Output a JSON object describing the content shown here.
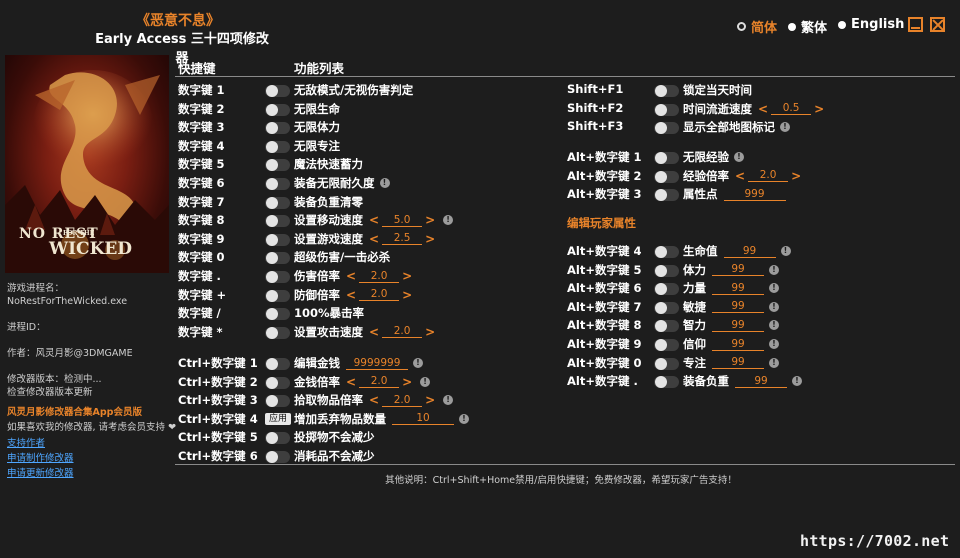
{
  "header": {
    "game_title": "《恶意不息》",
    "app_title": "Early Access 三十四项修改器",
    "languages": [
      {
        "label": "简体",
        "active": true
      },
      {
        "label": "繁体",
        "active": false
      },
      {
        "label": "English",
        "active": false
      }
    ]
  },
  "sidebar": {
    "cover_title_top": "NO REST",
    "cover_title_mid": "FOR THE",
    "cover_title_bottom": "WICKED",
    "process_name_label": "游戏进程名：",
    "process_name": "NoRestForTheWicked.exe",
    "process_id_label": "进程ID：",
    "author": "作者：风灵月影@3DMGAME",
    "version": "修改器版本：检测中...",
    "check_update": "检查修改器版本更新",
    "vip_title": "风灵月影修改器合集App会员版",
    "vip_desc": "如果喜欢我的修改器, 请考虑会员支持",
    "links": [
      "支持作者",
      "申请制作修改器",
      "申请更新修改器"
    ]
  },
  "table": {
    "col_hotkey": "快捷键",
    "col_function": "功能列表",
    "left_rows": [
      {
        "key": "数字键 1",
        "label": "无敌模式/无视伤害判定"
      },
      {
        "key": "数字键 2",
        "label": "无限生命"
      },
      {
        "key": "数字键 3",
        "label": "无限体力"
      },
      {
        "key": "数字键 4",
        "label": "无限专注"
      },
      {
        "key": "数字键 5",
        "label": "魔法快速蓄力"
      },
      {
        "key": "数字键 6",
        "label": "装备无限耐久度",
        "warn": "!"
      },
      {
        "key": "数字键 7",
        "label": "装备负重清零"
      },
      {
        "key": "数字键 8",
        "label": "设置移动速度",
        "value": "5.0",
        "warn": "!"
      },
      {
        "key": "数字键 9",
        "label": "设置游戏速度",
        "value": "2.5"
      },
      {
        "key": "数字键 0",
        "label": "超级伤害/一击必杀"
      },
      {
        "key": "数字键 .",
        "label": "伤害倍率",
        "value": "2.0"
      },
      {
        "key": "数字键 +",
        "label": "防御倍率",
        "value": "2.0"
      },
      {
        "key": "数字键 /",
        "label": "100%暴击率"
      },
      {
        "key": "数字键 *",
        "label": "设置攻击速度",
        "value": "2.0"
      }
    ],
    "ctrl_rows": [
      {
        "key": "Ctrl+数字键 1",
        "label": "编辑金钱",
        "input": "9999999",
        "warn": "!"
      },
      {
        "key": "Ctrl+数字键 2",
        "label": "金钱倍率",
        "value": "2.0",
        "warn": "!"
      },
      {
        "key": "Ctrl+数字键 3",
        "label": "拾取物品倍率",
        "value": "2.0",
        "warn": "!"
      },
      {
        "key": "Ctrl+数字键 4",
        "label": "增加丢弃物品数量",
        "input": "10",
        "warn": "!",
        "button": "应用"
      },
      {
        "key": "Ctrl+数字键 5",
        "label": "投掷物不会减少"
      },
      {
        "key": "Ctrl+数字键 6",
        "label": "消耗品不会减少"
      }
    ],
    "shift_rows": [
      {
        "key": "Shift+F1",
        "label": "锁定当天时间"
      },
      {
        "key": "Shift+F2",
        "label": "时间流逝速度",
        "value": "0.5"
      },
      {
        "key": "Shift+F3",
        "label": "显示全部地图标记",
        "warn": "!"
      }
    ],
    "alt_rows": [
      {
        "key": "Alt+数字键 1",
        "label": "无限经验",
        "warn": "!"
      },
      {
        "key": "Alt+数字键 2",
        "label": "经验倍率",
        "value": "2.0"
      },
      {
        "key": "Alt+数字键 3",
        "label": "属性点",
        "input": "999"
      }
    ],
    "section_title": "编辑玩家属性",
    "attr_rows": [
      {
        "key": "Alt+数字键 4",
        "label": "生命值",
        "input": "99",
        "warn": "!"
      },
      {
        "key": "Alt+数字键 5",
        "label": "体力",
        "input": "99",
        "warn": "!"
      },
      {
        "key": "Alt+数字键 6",
        "label": "力量",
        "input": "99",
        "warn": "!"
      },
      {
        "key": "Alt+数字键 7",
        "label": "敏捷",
        "input": "99",
        "warn": "!"
      },
      {
        "key": "Alt+数字键 8",
        "label": "智力",
        "input": "99",
        "warn": "!"
      },
      {
        "key": "Alt+数字键 9",
        "label": "信仰",
        "input": "99",
        "warn": "!"
      },
      {
        "key": "Alt+数字键 0",
        "label": "专注",
        "input": "99",
        "warn": "!"
      },
      {
        "key": "Alt+数字键 .",
        "label": "装备负重",
        "input": "99",
        "warn": "!"
      }
    ]
  },
  "footer": "其他说明：Ctrl+Shift+Home禁用/启用快捷键；免费修改器，希望玩家广告支持！",
  "watermark": "https://7002.net"
}
